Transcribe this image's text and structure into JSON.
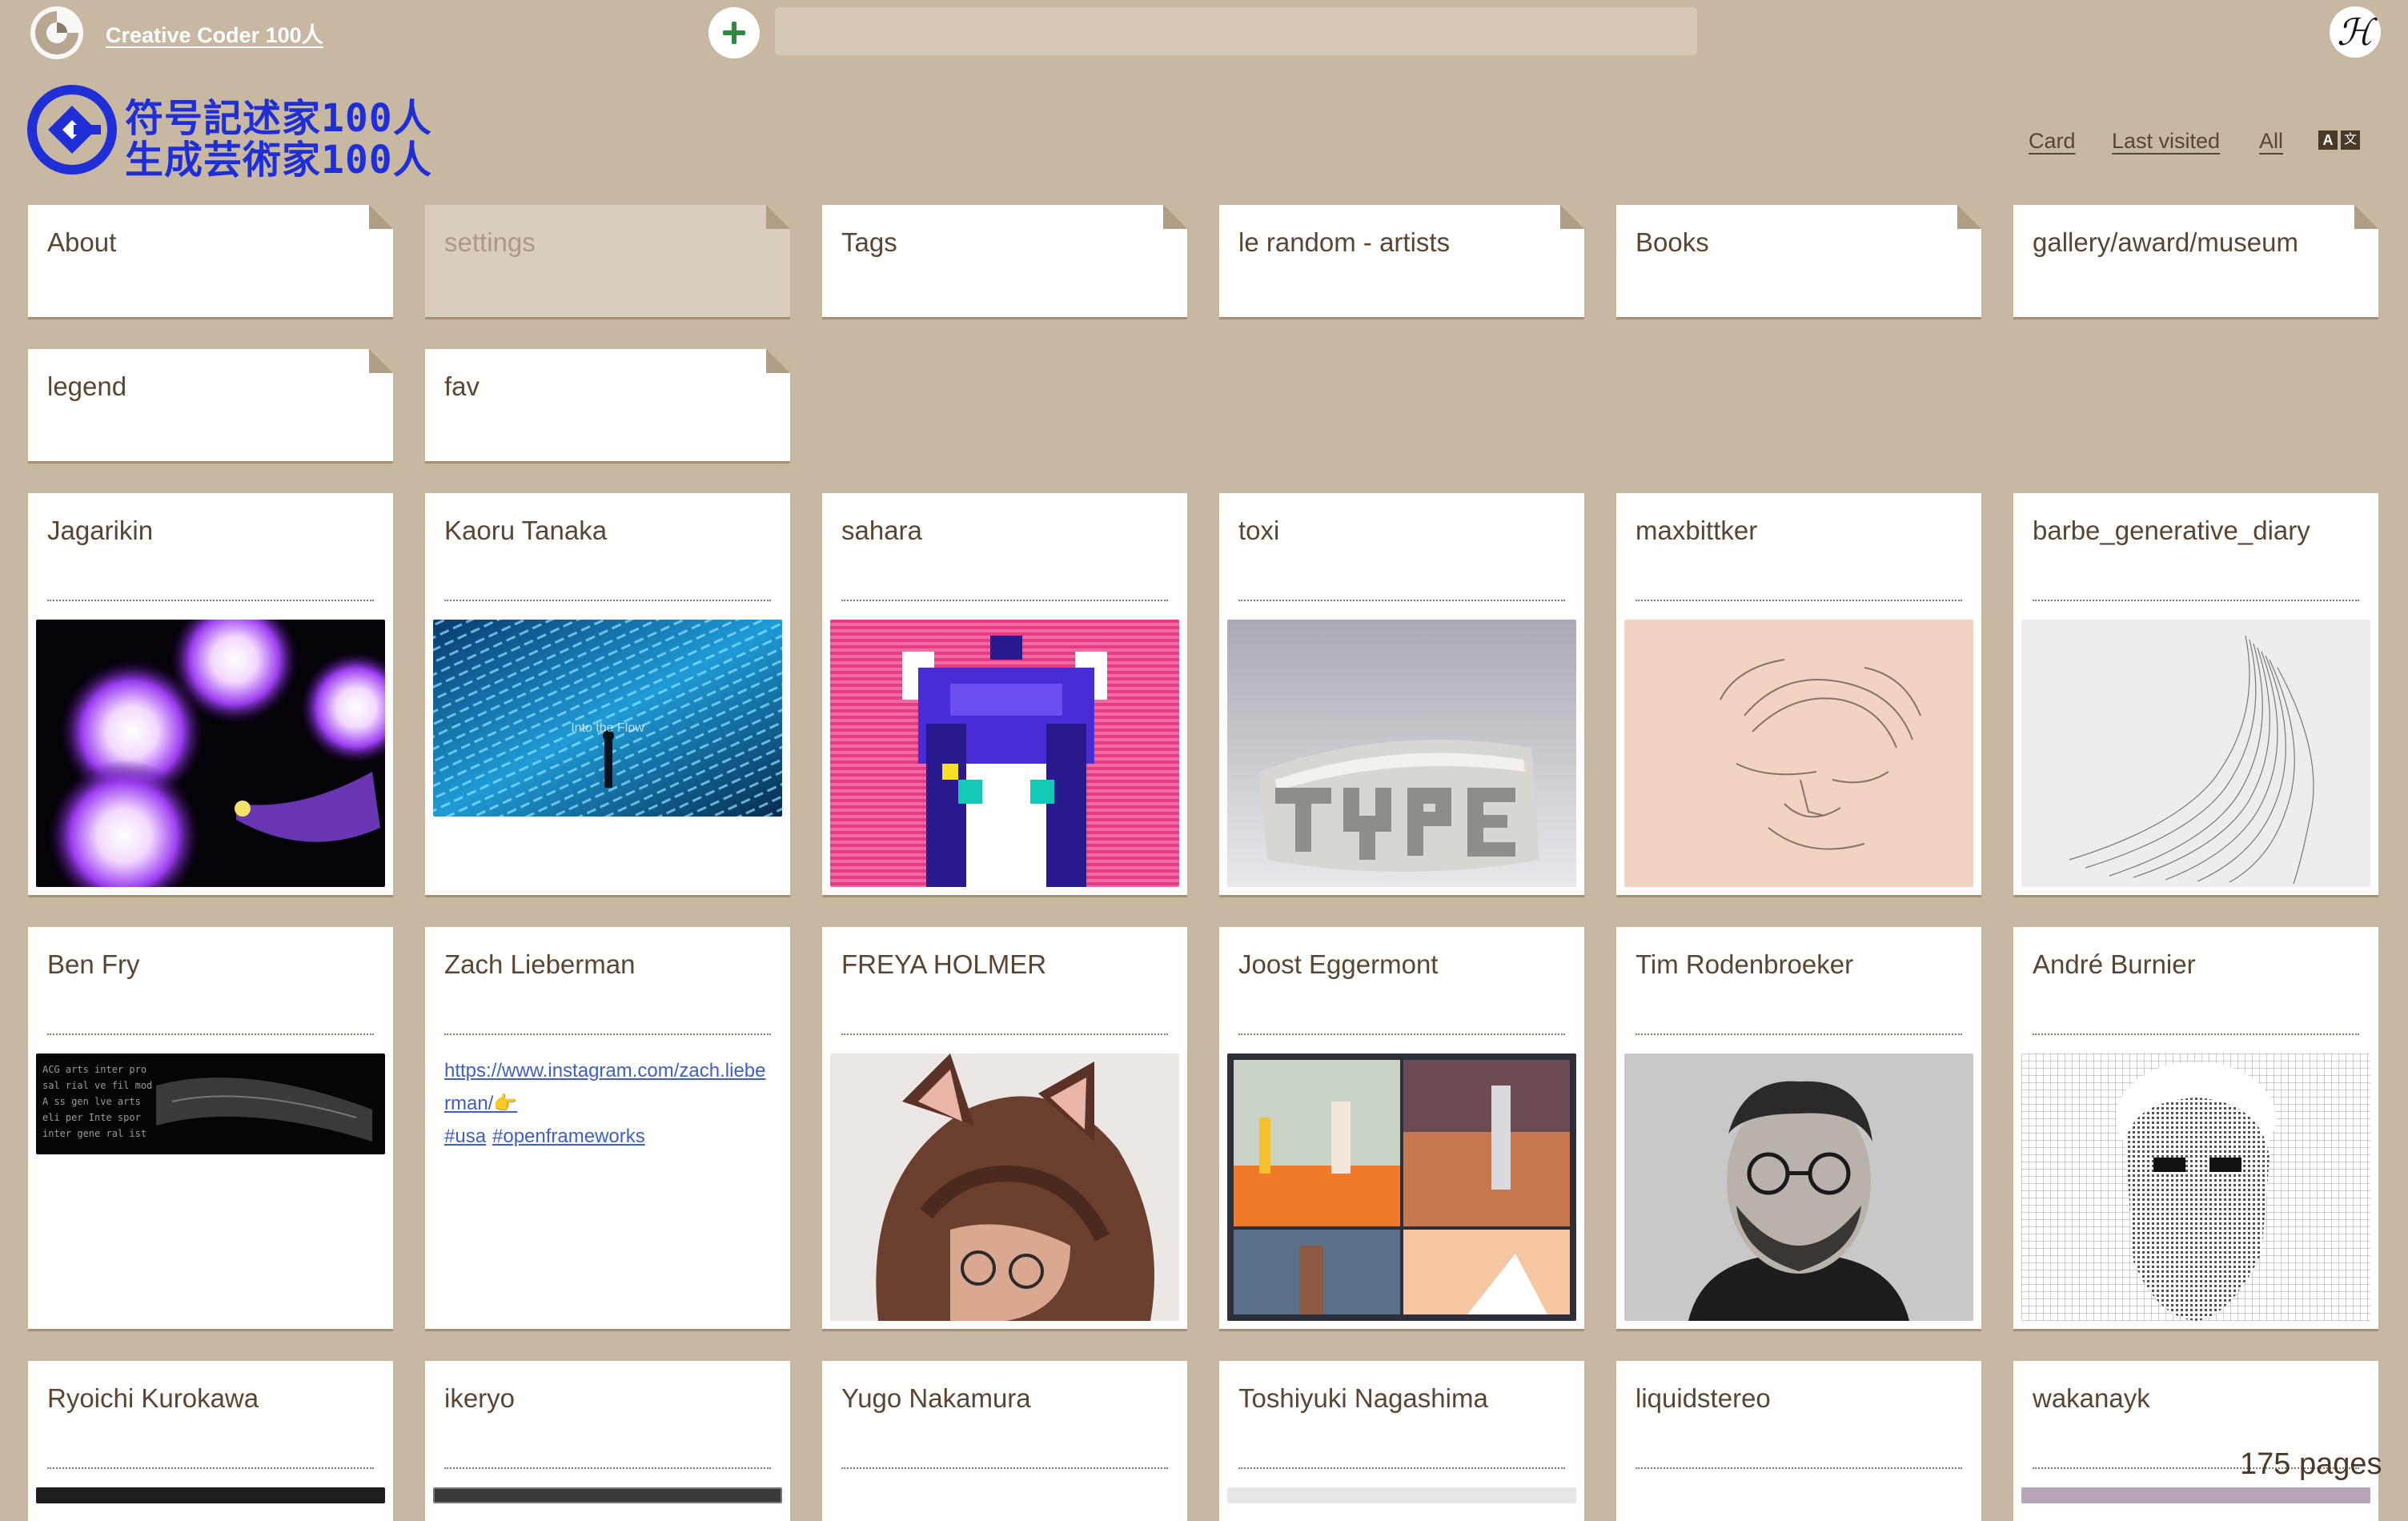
{
  "header": {
    "project_name": "Creative Coder 100人",
    "search": {
      "placeholder": "",
      "value": ""
    },
    "new_page_icon": "plus-circle-icon",
    "user_avatar_letter": "ℋ"
  },
  "big_logo": {
    "line1": "符号記述家100人",
    "line2": "生成芸術家100人"
  },
  "controls": {
    "view_mode": "Card",
    "sort": "Last visited",
    "filter": "All",
    "lang_icon": "translate-icon",
    "lang_a": "A",
    "lang_b": "文"
  },
  "pinned": [
    {
      "title": "About"
    },
    {
      "title": "settings"
    },
    {
      "title": "Tags"
    },
    {
      "title": "le random - artists"
    },
    {
      "title": "Books"
    },
    {
      "title": "gallery/award/museum"
    },
    {
      "title": "legend"
    },
    {
      "title": "fav"
    }
  ],
  "row1": [
    {
      "title": "Jagarikin",
      "thumb": "purple-orbs-image"
    },
    {
      "title": "Kaoru Tanaka",
      "thumb": "blue-particles-image",
      "overlay": "Into the Flow"
    },
    {
      "title": "sahara",
      "thumb": "pixel-cat-image"
    },
    {
      "title": "toxi",
      "thumb": "3d-type-image"
    },
    {
      "title": "maxbittker",
      "thumb": "pencil-sketch-image"
    },
    {
      "title": "barbe_generative_diary",
      "thumb": "smoke-lines-image"
    }
  ],
  "row2": [
    {
      "title": "Ben Fry",
      "thumb": "text-ribbon-image"
    },
    {
      "title": "Zach Lieberman",
      "link_line1": "https://www.instagram.com/zach.liebe",
      "link_line2": "rman/👉",
      "tag1": "#usa",
      "tag2": "#openframeworks"
    },
    {
      "title": "FREYA HOLMER",
      "thumb": "portrait-cat-ears-image"
    },
    {
      "title": "Joost Eggermont",
      "thumb": "lowpoly-scenes-image"
    },
    {
      "title": "Tim Rodenbroeker",
      "thumb": "portrait-glasses-image"
    },
    {
      "title": "André Burnier",
      "thumb": "ascii-portrait-image"
    }
  ],
  "row3": [
    {
      "title": "Ryoichi Kurokawa"
    },
    {
      "title": "ikeryo"
    },
    {
      "title": "Yugo Nakamura"
    },
    {
      "title": "Toshiyuki Nagashima"
    },
    {
      "title": "liquidstereo"
    },
    {
      "title": "wakanayk"
    }
  ],
  "footer": {
    "page_count": "175 pages"
  },
  "colors": {
    "background": "#c9b8a1",
    "card": "#ffffff",
    "text": "#5a4533",
    "logo_blue": "#1f2fd8",
    "link": "#3c5fcc",
    "add_green": "#2e8b3e"
  }
}
